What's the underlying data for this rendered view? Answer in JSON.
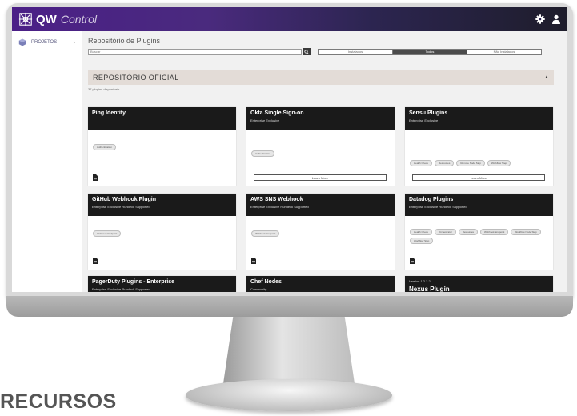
{
  "app": {
    "logo_strong": "QW",
    "logo_light": "Control"
  },
  "caption": "RECURSOS",
  "sidebar": {
    "items": [
      {
        "label": "PROJETOS",
        "icon": "cube-icon"
      }
    ]
  },
  "main": {
    "title": "Repositório de Plugins",
    "search_placeholder": "Buscar",
    "tabs": [
      {
        "label": "Instalados",
        "active": false
      },
      {
        "label": "Todos",
        "active": true
      },
      {
        "label": "Não Instalados",
        "active": false
      }
    ],
    "section_title": "REPOSITÓRIO OFICIAL",
    "count_text": "37 plugins disponíveis",
    "learn_more": "Learn More"
  },
  "cards": [
    {
      "title": "Ping Identity",
      "subtitle": "",
      "chips": [
        "Authentication"
      ]
    },
    {
      "title": "Okta Single Sign-on",
      "subtitle": "Enterprise Exclusive",
      "chips": [
        "Authentication"
      ]
    },
    {
      "title": "Sensu Plugins",
      "subtitle": "Enterprise Exclusive",
      "chips": [
        "Health Check",
        "Resources",
        "Remote Node Step",
        "Workflow Step"
      ]
    },
    {
      "title": "GitHub Webhook Plugin",
      "subtitle": "Enterprise Exclusive Rundeck Supported",
      "chips": [
        "Webhook Endpoint"
      ]
    },
    {
      "title": "AWS SNS Webhook",
      "subtitle": "Enterprise Exclusive Rundeck Supported",
      "chips": [
        "Webhook Endpoint"
      ]
    },
    {
      "title": "Datadog Plugins",
      "subtitle": "Enterprise Exclusive Rundeck Supported",
      "chips": [
        "Health Check",
        "Orchestrator",
        "Resources",
        "Webhook Endpoint",
        "Workflow Node Step",
        "Workflow Step"
      ]
    },
    {
      "title": "PagerDuty Plugins - Enterprise",
      "subtitle": "Enterprise Exclusive Rundeck Supported",
      "chips": []
    },
    {
      "title": "Chef Nodes",
      "subtitle": "Community",
      "chips": []
    },
    {
      "version": "Version 1.2.2.2",
      "title": "Nexus Plugin",
      "subtitle": "",
      "chips": []
    }
  ],
  "colors": {
    "topbar_start": "#4b1f87",
    "topbar_end": "#1e1d2b",
    "card_header": "#1a1a1a",
    "section_bar": "#e3dcd7"
  }
}
